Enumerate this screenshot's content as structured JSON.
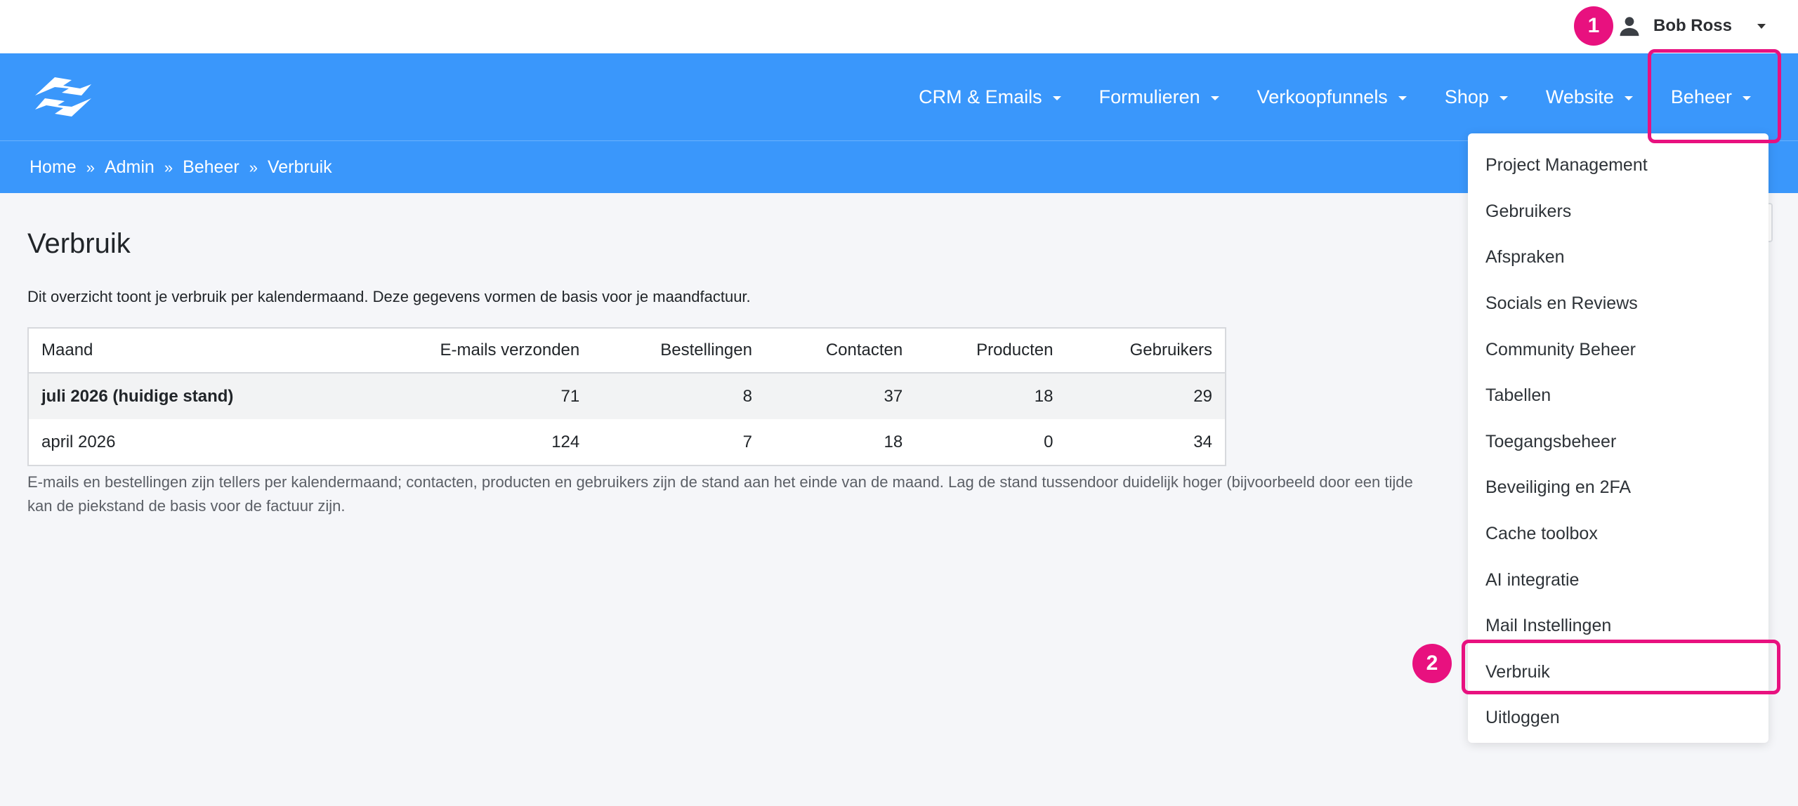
{
  "user": {
    "name": "Bob Ross",
    "icon": "user-icon"
  },
  "nav": {
    "logo_icon": "logo-icon",
    "items": [
      {
        "label": "CRM & Emails"
      },
      {
        "label": "Formulieren"
      },
      {
        "label": "Verkoopfunnels"
      },
      {
        "label": "Shop"
      },
      {
        "label": "Website"
      },
      {
        "label": "Beheer"
      }
    ]
  },
  "breadcrumb": [
    "Home",
    "Admin",
    "Beheer",
    "Verbruik"
  ],
  "breadcrumb_separator": "»",
  "page": {
    "title": "Verbruik",
    "intro": "Dit overzicht toont je verbruik per kalendermaand. Deze gegevens vormen de basis voor je maandfactuur.",
    "footnote_line1": "E-mails en bestellingen zijn tellers per kalendermaand; contacten, producten en gebruikers zijn de stand aan het einde van de maand. Lag de stand tussendoor duidelijk hoger (bijvoorbeeld door een tijde",
    "footnote_line2": "kan de piekstand de basis voor de factuur zijn."
  },
  "table": {
    "headers": [
      "Maand",
      "E-mails verzonden",
      "Bestellingen",
      "Contacten",
      "Producten",
      "Gebruikers"
    ],
    "rows": [
      [
        "juli 2026 (huidige stand)",
        "71",
        "8",
        "37",
        "18",
        "29"
      ],
      [
        "april 2026",
        "124",
        "7",
        "18",
        "0",
        "34"
      ]
    ]
  },
  "dropdown": {
    "items": [
      "Project Management",
      "Gebruikers",
      "Afspraken",
      "Socials en Reviews",
      "Community Beheer",
      "Tabellen",
      "Toegangsbeheer",
      "Beveiliging en 2FA",
      "Cache toolbox",
      "AI integratie",
      "Mail Instellingen",
      "Verbruik",
      "Uitloggen"
    ]
  },
  "annotations": {
    "badge1": "1",
    "badge2": "2",
    "color": "#e8117f"
  },
  "colors": {
    "brand": "#3a97fb",
    "highlight": "#e8117f"
  }
}
